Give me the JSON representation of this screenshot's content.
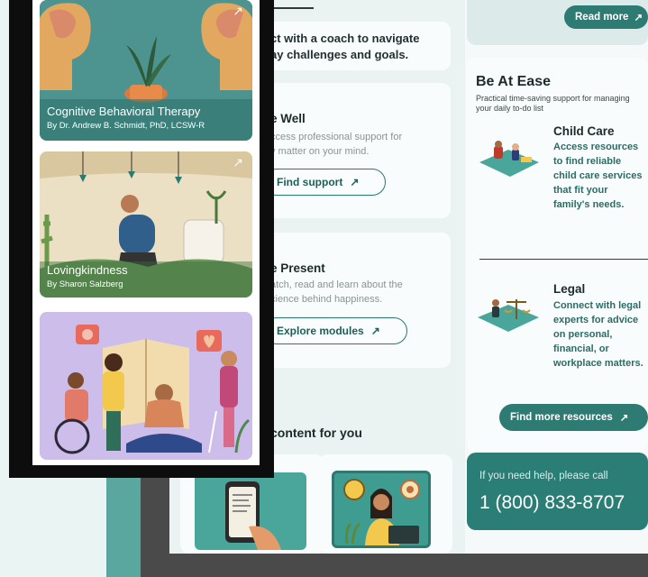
{
  "middle": {
    "intro_text": "ct with a coach to navigate\nay challenges and goals.",
    "be_well": {
      "title": "e Well",
      "desc": "ccess professional support for\ny matter on your mind.",
      "button": "Find support"
    },
    "be_present": {
      "title": "e Present",
      "desc": "atch, read and learn about the\ncience behind happiness.",
      "button": "Explore modules"
    },
    "content_heading": "content for you"
  },
  "right": {
    "read_more": "Read more",
    "ease": {
      "title": "Be At Ease",
      "subtitle": "Practical time-saving support for managing your daily to-do list"
    },
    "resources": [
      {
        "title": "Child Care",
        "desc": "Access resources to find reliable child care services that fit your family's needs."
      },
      {
        "title": "Legal",
        "desc": "Connect with legal experts for advice on personal, financial, or workplace matters."
      }
    ],
    "find_more": "Find more resources",
    "help_text": "If you need help, please call",
    "phone": "1 (800) 833-8707"
  },
  "phone_app": {
    "cards": [
      {
        "title": "Cognitive Behavioral Therapy",
        "author": "By Dr. Andrew B. Schmidt, PhD, LCSW-R"
      },
      {
        "title": "Lovingkindness",
        "author": "By Sharon Salzberg"
      }
    ]
  },
  "icons": {
    "arrow": "↗"
  },
  "colors": {
    "brand_teal": "#2d7b73",
    "accent_light": "#e9f4f3"
  }
}
